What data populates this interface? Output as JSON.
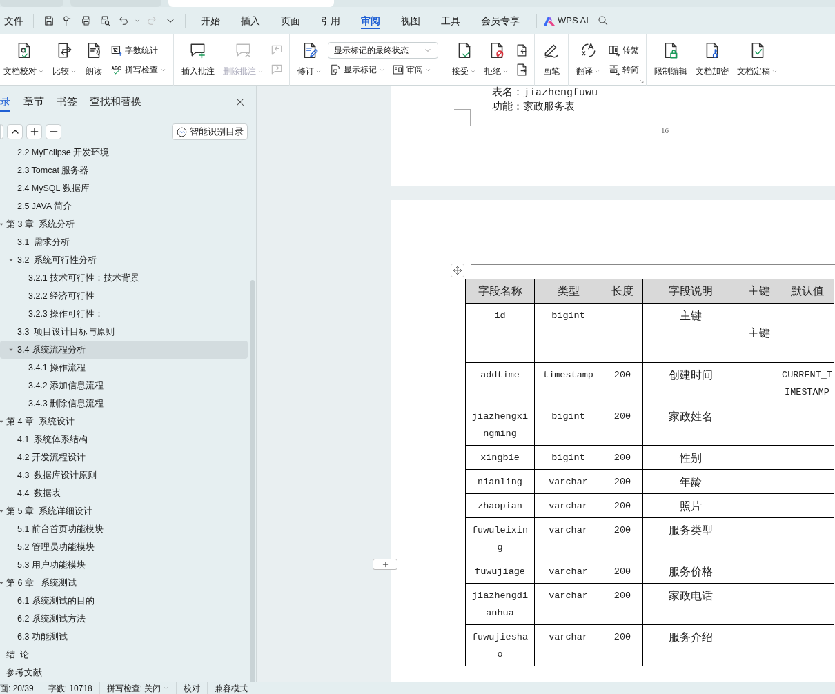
{
  "document_tabs": [
    {
      "selected": false
    },
    {
      "selected": false
    },
    {
      "selected": true
    }
  ],
  "menu": {
    "file": "文件",
    "tabs": [
      {
        "label": "开始",
        "selected": false
      },
      {
        "label": "插入",
        "selected": false
      },
      {
        "label": "页面",
        "selected": false
      },
      {
        "label": "引用",
        "selected": false
      },
      {
        "label": "审阅",
        "selected": true
      },
      {
        "label": "视图",
        "selected": false
      },
      {
        "label": "工具",
        "selected": false
      },
      {
        "label": "会员专享",
        "selected": false
      }
    ],
    "ai_label": "WPS AI"
  },
  "ribbon": {
    "groups": [
      [
        {
          "kind": "large",
          "label": "文档校对",
          "dropdown": true,
          "disabled": false
        },
        {
          "kind": "large",
          "label": "比较",
          "dropdown": true,
          "disabled": false
        },
        {
          "kind": "large",
          "label": "朗读",
          "dropdown": false,
          "disabled": false
        },
        {
          "kind": "stack",
          "items": [
            {
              "kind": "small",
              "label": "字数统计",
              "dropdown": false,
              "disabled": false
            },
            {
              "kind": "small",
              "label": "拼写检查",
              "dropdown": true,
              "disabled": false
            }
          ]
        }
      ],
      [
        {
          "kind": "large",
          "label": "插入批注",
          "dropdown": false,
          "disabled": false
        },
        {
          "kind": "large",
          "label": "删除批注",
          "dropdown": true,
          "disabled": true
        },
        {
          "kind": "stack",
          "items": [
            {
              "kind": "icon",
              "disabled": true
            },
            {
              "kind": "icon",
              "disabled": true
            }
          ]
        }
      ],
      [
        {
          "kind": "large",
          "label": "修订",
          "dropdown": true,
          "disabled": false
        },
        {
          "kind": "stack",
          "items": [
            {
              "kind": "select",
              "value": "显示标记的最终状态"
            },
            {
              "kind": "row",
              "items": [
                {
                  "kind": "small",
                  "label": "显示标记",
                  "dropdown": true,
                  "disabled": false
                },
                {
                  "kind": "small",
                  "label": "审阅",
                  "dropdown": true,
                  "disabled": false
                }
              ]
            }
          ]
        }
      ],
      [
        {
          "kind": "large",
          "label": "接受",
          "dropdown": true,
          "disabled": false
        },
        {
          "kind": "large",
          "label": "拒绝",
          "dropdown": true,
          "disabled": false
        },
        {
          "kind": "stack",
          "items": [
            {
              "kind": "icon",
              "disabled": false
            },
            {
              "kind": "icon",
              "disabled": false
            }
          ]
        }
      ],
      [
        {
          "kind": "large",
          "label": "画笔",
          "dropdown": false,
          "disabled": false
        }
      ],
      [
        {
          "kind": "large",
          "label": "翻译",
          "dropdown": true,
          "disabled": false
        },
        {
          "kind": "stack",
          "items": [
            {
              "kind": "small",
              "label": "转繁",
              "dropdown": false,
              "disabled": false
            },
            {
              "kind": "small",
              "label": "转简",
              "dropdown": false,
              "disabled": false
            }
          ]
        }
      ],
      [
        {
          "kind": "large",
          "label": "限制编辑",
          "dropdown": false,
          "disabled": false
        },
        {
          "kind": "large",
          "label": "文档加密",
          "dropdown": false,
          "disabled": false
        },
        {
          "kind": "large",
          "label": "文档定稿",
          "dropdown": true,
          "disabled": false
        }
      ]
    ]
  },
  "nav": {
    "tabs": [
      {
        "label": "录",
        "selected": true
      },
      {
        "label": "章节",
        "selected": false
      },
      {
        "label": "书签",
        "selected": false
      },
      {
        "label": "查找和替换",
        "selected": false
      }
    ],
    "smart_button": "智能识别目录",
    "continued_items": [
      {
        "label": "2.2 MyEclipse 开发环境",
        "selected": false
      },
      {
        "label": "2.3 Tomcat 服务器",
        "selected": false
      },
      {
        "label": "2.4 MySQL 数据库",
        "selected": false
      },
      {
        "label": "2.5 JAVA 简介",
        "selected": false
      }
    ],
    "items": [
      {
        "label": "第 3 章  系统分析",
        "selected": false,
        "expanded": true,
        "children": [
          {
            "label": "3.1  需求分析",
            "selected": false
          },
          {
            "label": "3.2  系统可行性分析",
            "selected": false,
            "expanded": true,
            "children": [
              {
                "label": "3.2.1 技术可行性：技术背景",
                "selected": false
              },
              {
                "label": "3.2.2 经济可行性",
                "selected": false
              },
              {
                "label": "3.2.3 操作可行性：",
                "selected": false
              }
            ]
          },
          {
            "label": "3.3  项目设计目标与原则",
            "selected": false
          },
          {
            "label": "3.4 系统流程分析",
            "selected": true,
            "expanded": true,
            "children": [
              {
                "label": "3.4.1 操作流程",
                "selected": false
              },
              {
                "label": "3.4.2 添加信息流程",
                "selected": false
              },
              {
                "label": "3.4.3 删除信息流程",
                "selected": false
              }
            ]
          }
        ]
      },
      {
        "label": "第 4 章  系统设计",
        "selected": false,
        "expanded": true,
        "children": [
          {
            "label": "4.1  系统体系结构",
            "selected": false
          },
          {
            "label": "4.2 开发流程设计",
            "selected": false
          },
          {
            "label": "4.3  数据库设计原则",
            "selected": false
          },
          {
            "label": "4.4  数据表",
            "selected": false
          }
        ]
      },
      {
        "label": "第 5 章  系统详细设计",
        "selected": false,
        "expanded": true,
        "children": [
          {
            "label": "5.1 前台首页功能模块",
            "selected": false
          },
          {
            "label": "5.2 管理员功能模块",
            "selected": false
          },
          {
            "label": "5.3 用户功能模块",
            "selected": false
          }
        ]
      },
      {
        "label": "第 6 章   系统测试",
        "selected": false,
        "expanded": true,
        "children": [
          {
            "label": "6.1 系统测试的目的",
            "selected": false
          },
          {
            "label": "6.2 系统测试方法",
            "selected": false
          },
          {
            "label": "6.3 功能测试",
            "selected": false
          }
        ]
      },
      {
        "label": "结  论",
        "selected": false
      },
      {
        "label": "参考文献",
        "selected": false
      }
    ]
  },
  "document": {
    "page_lines": [
      "表名：jiazhengfuwu",
      "功能：家政服务表"
    ],
    "page_number": "16",
    "table": {
      "columns": [
        "字段名称",
        "类型",
        "长度",
        "字段说明",
        "主键",
        "默认值"
      ],
      "rows": [
        [
          "id",
          "bigint",
          "",
          "主键",
          "主键",
          ""
        ],
        [
          "addtime",
          "timestamp",
          "200",
          "创建时间",
          "",
          "CURRENT_TIMESTAMP"
        ],
        [
          "jiazhengxingming",
          "bigint",
          "200",
          "家政姓名",
          "",
          ""
        ],
        [
          "xingbie",
          "bigint",
          "200",
          "性别",
          "",
          ""
        ],
        [
          "nianling",
          "varchar",
          "200",
          "年龄",
          "",
          ""
        ],
        [
          "zhaopian",
          "varchar",
          "200",
          "照片",
          "",
          ""
        ],
        [
          "fuwuleixing",
          "varchar",
          "200",
          "服务类型",
          "",
          ""
        ],
        [
          "fuwujiage",
          "varchar",
          "200",
          "服务价格",
          "",
          ""
        ],
        [
          "jiazhengdianhua",
          "varchar",
          "200",
          "家政电话",
          "",
          ""
        ],
        [
          "fuwujieshao",
          "varchar",
          "200",
          "服务介绍",
          "",
          ""
        ]
      ]
    }
  },
  "status_bar": {
    "items": [
      {
        "label": "面: 20/39",
        "dropdown": false
      },
      {
        "label": "字数: 10718",
        "dropdown": false
      },
      {
        "label": "拼写检查: 关闭",
        "dropdown": true
      },
      {
        "label": "校对",
        "dropdown": false
      },
      {
        "label": "兼容模式",
        "dropdown": false
      }
    ]
  }
}
